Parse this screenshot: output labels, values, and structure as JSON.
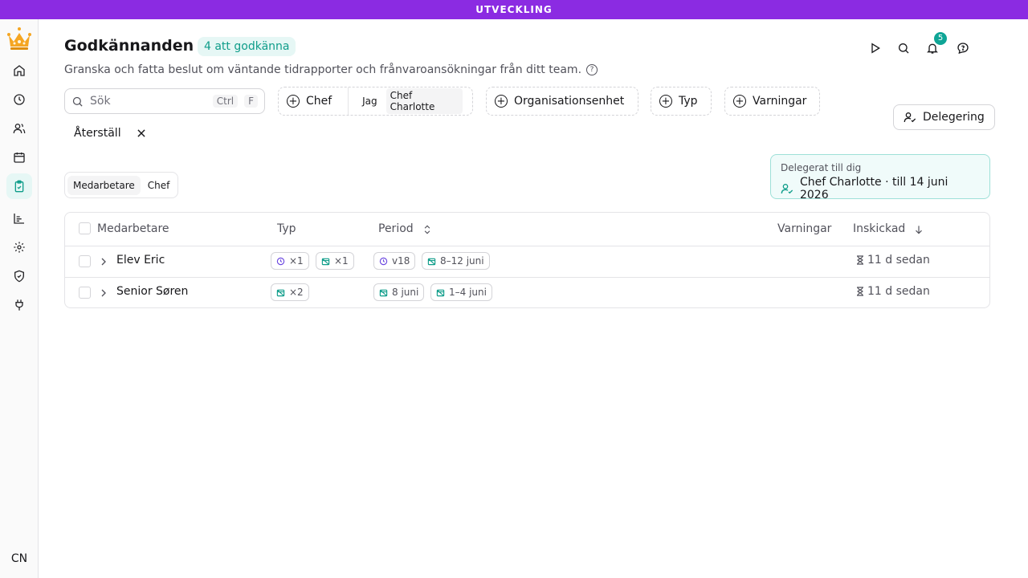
{
  "banner": "UTVECKLING",
  "sidebar": {
    "items": [
      {
        "icon": "home-icon"
      },
      {
        "icon": "clock-icon"
      },
      {
        "icon": "users-icon"
      },
      {
        "icon": "calendar-icon"
      },
      {
        "icon": "clipboard-check-icon",
        "active": true
      },
      {
        "icon": "bar-chart-icon"
      },
      {
        "icon": "gear-icon"
      },
      {
        "icon": "shield-check-icon"
      },
      {
        "icon": "plug-icon"
      }
    ],
    "avatar": "CN"
  },
  "header": {
    "title": "Godkännanden",
    "badge": "4 att godkänna",
    "subtitle": "Granska och fatta beslut om väntande tidrapporter och frånvaroansökningar från ditt team.",
    "notification_count": "5"
  },
  "filters": {
    "search_placeholder": "Sök",
    "kbd_ctrl": "Ctrl",
    "kbd_f": "F",
    "chef_label": "Chef",
    "chef_option_me": "Jag",
    "chef_option_selected": "Chef Charlotte",
    "org_label": "Organisationsenhet",
    "type_label": "Typ",
    "warnings_label": "Varningar",
    "reset_label": "Återställ",
    "delegation_button": "Delegering"
  },
  "view_toggle": {
    "employee": "Medarbetare",
    "manager": "Chef"
  },
  "delegation_card": {
    "label": "Delegerat till dig",
    "value": "Chef Charlotte · till 14 juni 2026"
  },
  "table": {
    "headers": {
      "employee": "Medarbetare",
      "type": "Typ",
      "period": "Period",
      "warnings": "Varningar",
      "submitted": "Inskickad"
    },
    "rows": [
      {
        "name": "Elev Eric",
        "type_tags": [
          "×1",
          "×1"
        ],
        "period_tags": [
          "v18",
          "8–12 juni"
        ],
        "submitted": "11 d sedan"
      },
      {
        "name": "Senior Søren",
        "type_tags": [
          "×2"
        ],
        "period_tags": [
          "8 juni",
          "1–4 juni"
        ],
        "submitted": "11 d sedan"
      }
    ]
  }
}
